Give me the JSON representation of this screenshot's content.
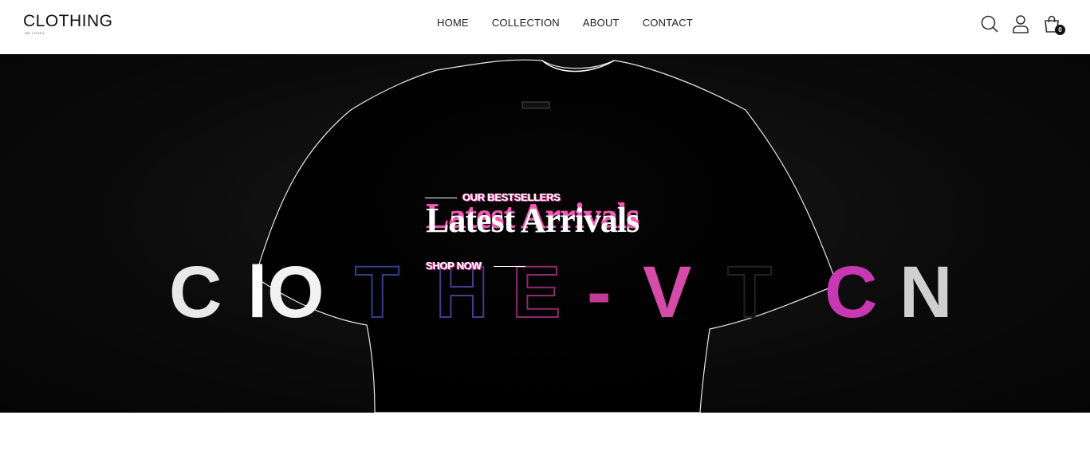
{
  "header": {
    "logo": {
      "text": "CLOTHING",
      "tagline": "WE LOVEA"
    },
    "nav": [
      {
        "label": "HOME"
      },
      {
        "label": "COLLECTION"
      },
      {
        "label": "ABOUT"
      },
      {
        "label": "CONTACT"
      }
    ],
    "icons": {
      "search": "search-icon",
      "account": "user-icon",
      "cart": "shopping-bag-icon"
    },
    "cart_count": "0"
  },
  "hero": {
    "eyebrow": "OUR BESTSELLERS",
    "headline": "Latest Arrivals",
    "cta": "SHOP NOW",
    "backdrop_text": "CLOTHE-VTON",
    "colors": {
      "accent": "#e64aa6",
      "background": "#0c0c0c"
    }
  }
}
